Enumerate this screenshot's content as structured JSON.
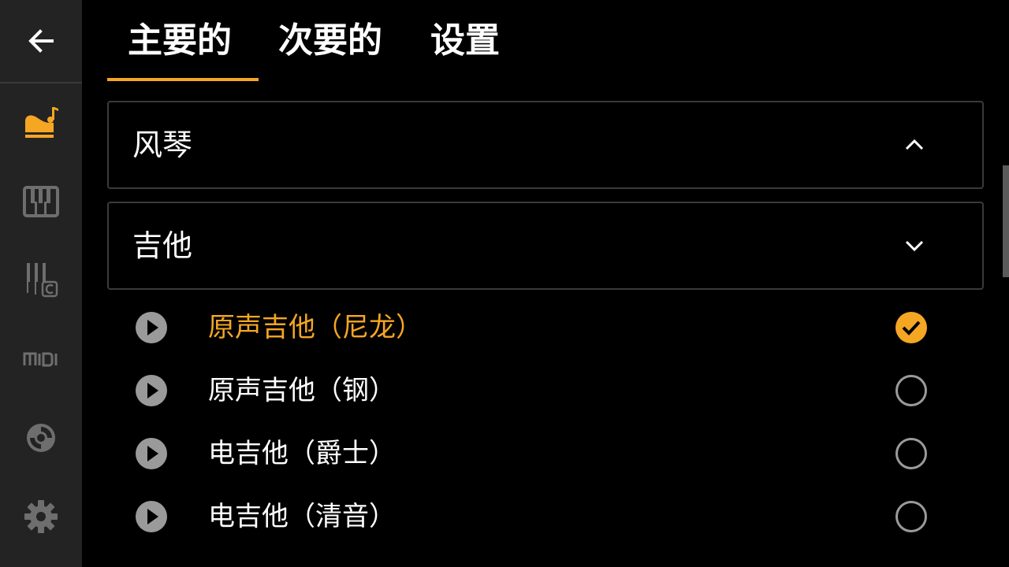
{
  "colors": {
    "accent": "#f5a623",
    "sidebar_bg": "#232323",
    "icon_inactive": "#6e6e6e",
    "radio_inactive": "#9a9a9a"
  },
  "sidebar": {
    "back_icon": "arrow-left-icon",
    "items": [
      {
        "icon": "grand-piano-music-note-icon",
        "active": true
      },
      {
        "icon": "piano-keyboard-icon",
        "active": false
      },
      {
        "icon": "piano-chord-c-icon",
        "active": false
      },
      {
        "icon": "midi-icon",
        "active": false
      },
      {
        "icon": "disc-icon",
        "active": false
      },
      {
        "icon": "gear-icon",
        "active": false
      }
    ]
  },
  "tabs": [
    {
      "label": "主要的",
      "active": true
    },
    {
      "label": "次要的",
      "active": false
    },
    {
      "label": "设置",
      "active": false
    }
  ],
  "categories": [
    {
      "label": "风琴",
      "expanded": true,
      "chevron": "chevron-up-icon"
    },
    {
      "label": "吉他",
      "expanded": false,
      "chevron": "chevron-down-icon"
    }
  ],
  "instruments": [
    {
      "label": "原声吉他（尼龙）",
      "selected": true
    },
    {
      "label": "原声吉他（钢）",
      "selected": false
    },
    {
      "label": "电吉他（爵士）",
      "selected": false
    },
    {
      "label": "电吉他（清音）",
      "selected": false
    }
  ]
}
